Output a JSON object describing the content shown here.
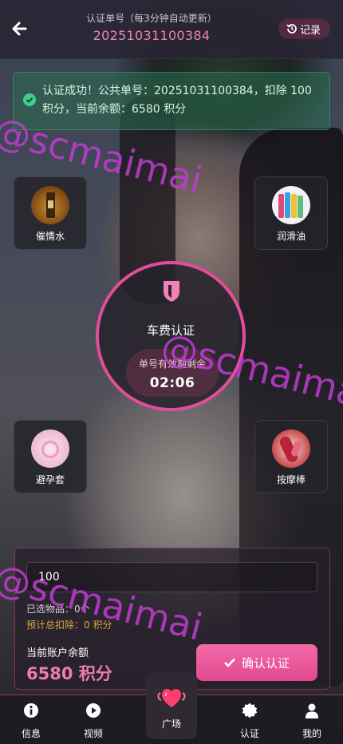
{
  "header": {
    "label": "认证单号（每3分钟自动更新）",
    "order_no": "20251031100384",
    "record_label": "记录"
  },
  "alert": {
    "text": "认证成功！公共单号：20251031100384，扣除 100 积分，当前余额：6580 积分"
  },
  "products": [
    {
      "name": "催情水"
    },
    {
      "name": "润滑油"
    },
    {
      "name": "避孕套"
    },
    {
      "name": "按摩棒"
    }
  ],
  "center": {
    "title": "车费认证",
    "countdown_label": "单号有效期剩余",
    "countdown": "02:06"
  },
  "panel": {
    "quantity": "100",
    "selected_label": "已选物品：0个",
    "deduction_label": "预计总扣除：0 积分",
    "balance_label": "当前账户余额",
    "balance_value": "6580 积分",
    "confirm_label": "确认认证"
  },
  "watermark": "@scmaimai",
  "tabs": [
    {
      "label": "信息",
      "icon": "info-icon"
    },
    {
      "label": "视频",
      "icon": "play-icon"
    },
    {
      "label": "广场",
      "icon": "heart-icon"
    },
    {
      "label": "认证",
      "icon": "badge-icon"
    },
    {
      "label": "我的",
      "icon": "user-icon"
    }
  ],
  "colors": {
    "accent": "#e24d9b",
    "success": "#2e7d5b",
    "order": "#f080b8"
  }
}
